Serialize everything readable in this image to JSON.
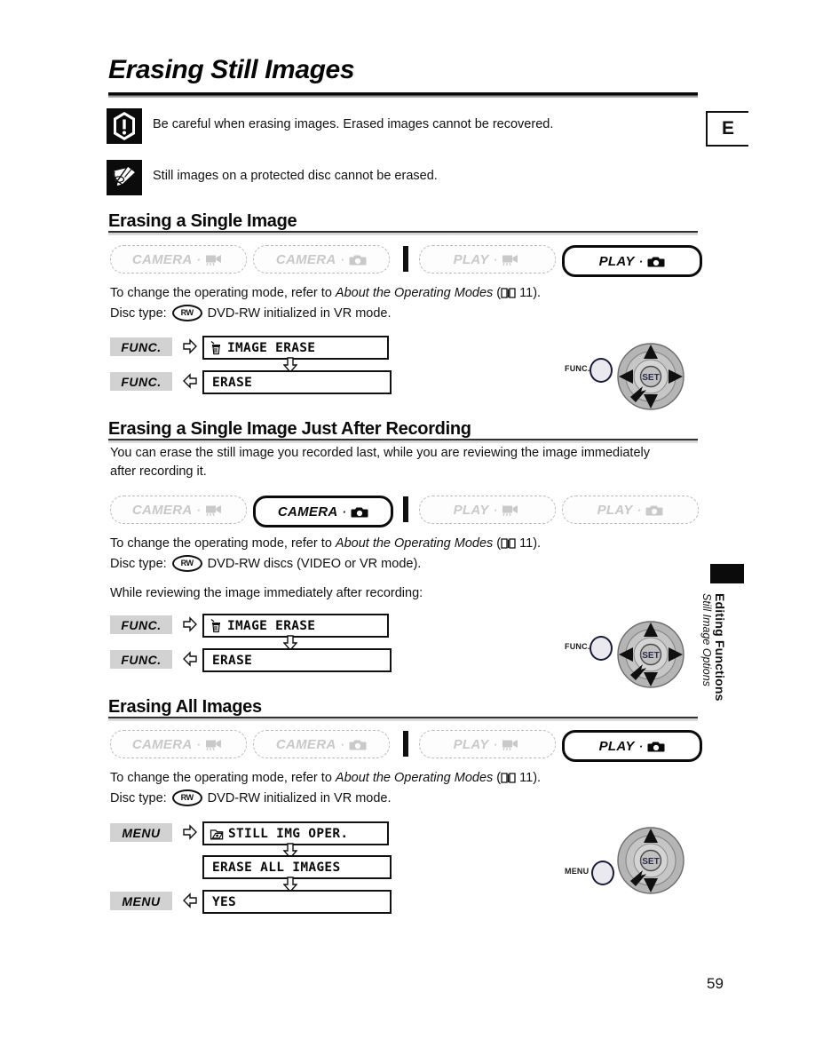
{
  "page": {
    "title": "Erasing Still Images",
    "number": "59",
    "edition_tab": "E",
    "side_tab": {
      "bold": "Editing Functions",
      "italic": "Still Image Options"
    }
  },
  "notes": [
    {
      "icon": "caution-icon",
      "text": "Be careful when erasing images. Erased images cannot be recovered."
    },
    {
      "icon": "note-pencil-icon",
      "text": "Still images on a protected disc cannot be erased."
    }
  ],
  "mode_labels": {
    "camera_video": "CAMERA",
    "camera_photo": "CAMERA",
    "play_video": "PLAY",
    "play_photo": "PLAY",
    "separator_dot": "·"
  },
  "common": {
    "operating_mode_line_1": "To change the operating mode, refer to ",
    "operating_mode_italic": "About the Operating Modes",
    "operating_mode_paren_open": " (",
    "operating_mode_page": "11",
    "operating_mode_paren_close": ").",
    "disc_type_label": "Disc type:",
    "rw_icon_text": "RW"
  },
  "sections": [
    {
      "heading": "Erasing a Single Image",
      "modes": [
        {
          "label": "CAMERA",
          "glyph": "camcorder-icon",
          "active": false
        },
        {
          "label": "CAMERA",
          "glyph": "photo-camera-icon",
          "active": false
        },
        {
          "label": "PLAY",
          "glyph": "camcorder-icon",
          "active": false
        },
        {
          "label": "PLAY",
          "glyph": "photo-camera-icon",
          "active": true
        }
      ],
      "disc_type": "DVD-RW initialized in VR mode.",
      "flow": {
        "button": "FUNC.",
        "steps": [
          {
            "label": "IMAGE ERASE",
            "icon": "trash-icon",
            "button": "FUNC.",
            "arrow": "right"
          },
          {
            "label": "ERASE",
            "icon": "",
            "button": "FUNC.",
            "arrow": "left"
          }
        ]
      },
      "control": {
        "button_name": "FUNC.",
        "joystick": "SET",
        "arrows": [
          "up",
          "down",
          "left",
          "right"
        ]
      }
    },
    {
      "heading": "Erasing a Single Image Just After Recording",
      "intro": "You can erase the still image you recorded last, while you are reviewing the image immediately after recording it.",
      "modes": [
        {
          "label": "CAMERA",
          "glyph": "camcorder-icon",
          "active": false
        },
        {
          "label": "CAMERA",
          "glyph": "photo-camera-icon",
          "active": true
        },
        {
          "label": "PLAY",
          "glyph": "camcorder-icon",
          "active": false
        },
        {
          "label": "PLAY",
          "glyph": "photo-camera-icon",
          "active": false
        }
      ],
      "disc_type": "DVD-RW discs (VIDEO or VR mode).",
      "precondition": "While reviewing the image immediately after recording:",
      "flow": {
        "button": "FUNC.",
        "steps": [
          {
            "label": "IMAGE ERASE",
            "icon": "trash-icon",
            "button": "FUNC.",
            "arrow": "right"
          },
          {
            "label": "ERASE",
            "icon": "",
            "button": "FUNC.",
            "arrow": "left"
          }
        ]
      },
      "control": {
        "button_name": "FUNC.",
        "joystick": "SET",
        "arrows": [
          "up",
          "down",
          "left",
          "right"
        ]
      }
    },
    {
      "heading": "Erasing All Images",
      "modes": [
        {
          "label": "CAMERA",
          "glyph": "camcorder-icon",
          "active": false
        },
        {
          "label": "CAMERA",
          "glyph": "photo-camera-icon",
          "active": false
        },
        {
          "label": "PLAY",
          "glyph": "camcorder-icon",
          "active": false
        },
        {
          "label": "PLAY",
          "glyph": "photo-camera-icon",
          "active": true
        }
      ],
      "disc_type": "DVD-RW initialized in VR mode.",
      "flow": {
        "button": "MENU",
        "steps": [
          {
            "label": "STILL IMG OPER.",
            "icon": "card-folder-icon",
            "button": "MENU",
            "arrow": "right"
          },
          {
            "label": "ERASE ALL IMAGES",
            "icon": "",
            "button": "",
            "arrow": ""
          },
          {
            "label": "YES",
            "icon": "",
            "button": "MENU",
            "arrow": "left"
          }
        ]
      },
      "control": {
        "button_name": "MENU",
        "joystick": "SET",
        "arrows": [
          "up",
          "down"
        ]
      }
    }
  ]
}
